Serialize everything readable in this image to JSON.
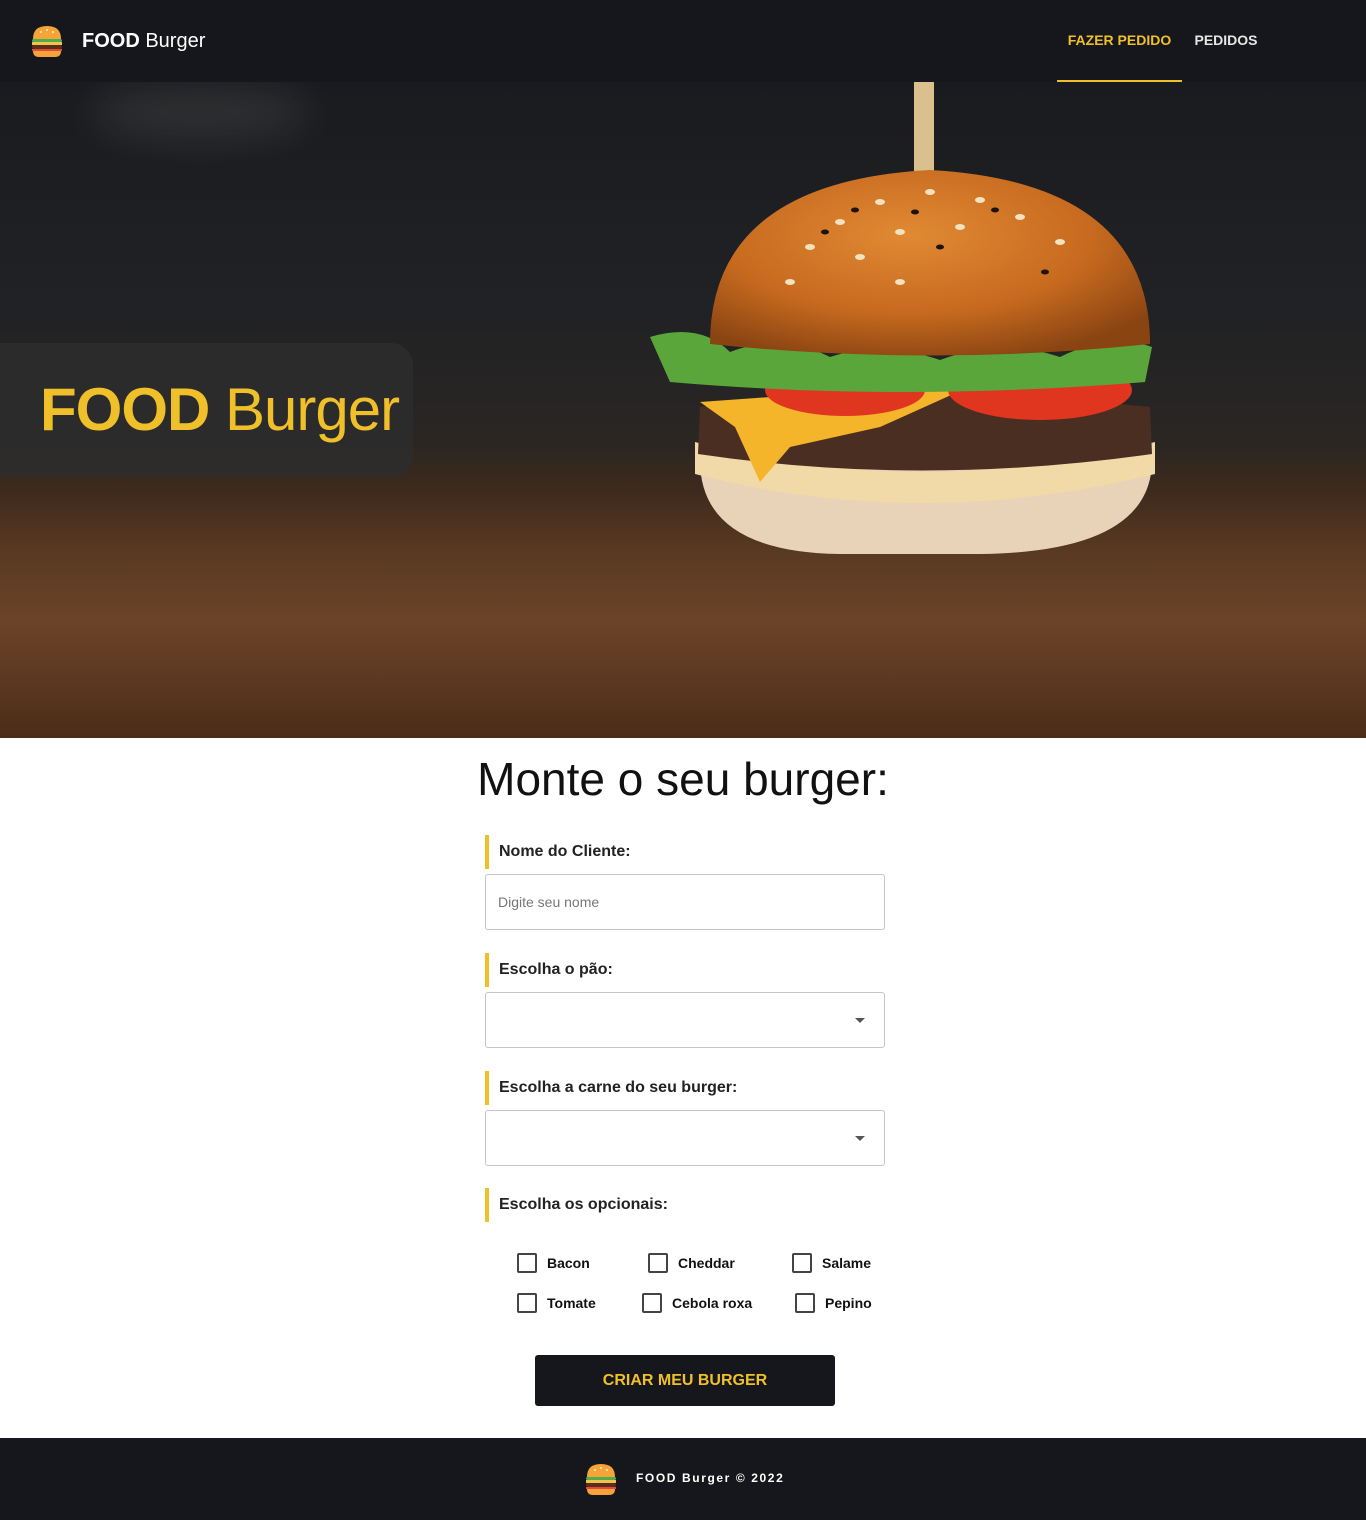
{
  "nav": {
    "brand_bold": "FOOD",
    "brand_rest": " Burger",
    "links": [
      {
        "label": "FAZER PEDIDO",
        "active": true
      },
      {
        "label": "PEDIDOS",
        "active": false
      }
    ]
  },
  "hero": {
    "title_bold": "FOOD",
    "title_rest": " Burger"
  },
  "form": {
    "title": "Monte o seu burger:",
    "name_label": "Nome do Cliente:",
    "name_placeholder": "Digite seu nome",
    "name_value": "",
    "bread_label": "Escolha o pão:",
    "bread_value": "",
    "meat_label": "Escolha a carne do seu burger:",
    "meat_value": "",
    "optionals_label": "Escolha os opcionais:",
    "optionals": [
      {
        "label": "Bacon",
        "checked": false
      },
      {
        "label": "Cheddar",
        "checked": false
      },
      {
        "label": "Salame",
        "checked": false
      },
      {
        "label": "Tomate",
        "checked": false
      },
      {
        "label": "Cebola roxa",
        "checked": false
      },
      {
        "label": "Pepino",
        "checked": false
      }
    ],
    "submit_label": "CRIAR MEU BURGER"
  },
  "footer": {
    "text": "FOOD Burger © 2022"
  },
  "colors": {
    "accent": "#f0c02a",
    "dark": "#16171c"
  }
}
